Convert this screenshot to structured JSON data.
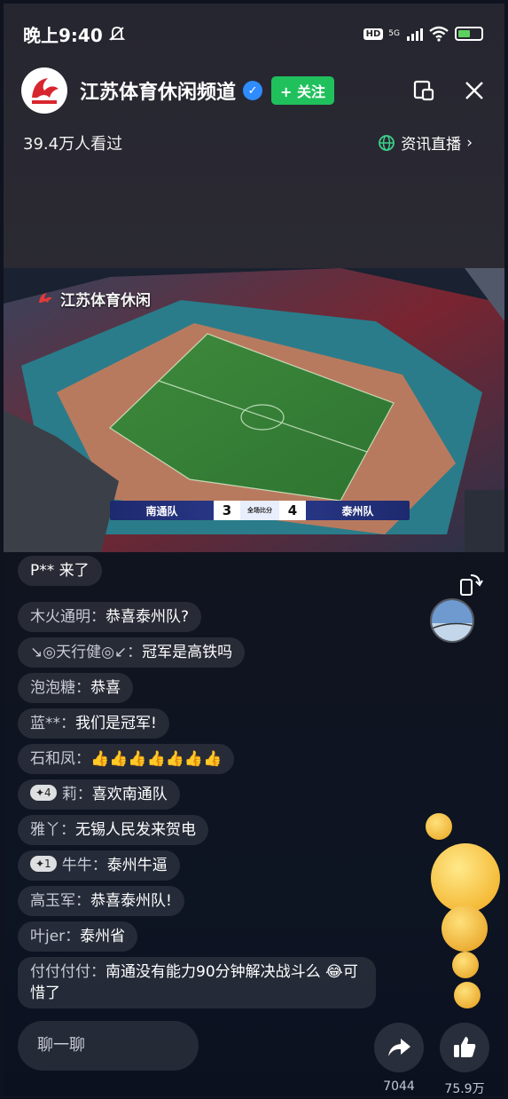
{
  "status_bar": {
    "time": "晚上9:40",
    "hd": "HD",
    "network": "5G"
  },
  "header": {
    "channel_name": "江苏体育休闲频道",
    "follow_label": "+ 关注",
    "viewers": "39.4万人看过",
    "news_live_label": "资讯直播",
    "icons": [
      "minimize-window-icon",
      "close-icon"
    ]
  },
  "video": {
    "watermark": "江苏体育休闲",
    "score": {
      "home_team": "南通队",
      "home_score": "3",
      "away_team": "泰州队",
      "away_score": "4",
      "middle_text": "全场比分"
    }
  },
  "comments": [
    {
      "user": "P** 来了",
      "msg": ""
    },
    {
      "user": "木火通明：",
      "msg": "恭喜泰州队?"
    },
    {
      "user": "↘◎天行健◎↙：",
      "msg": "冠军是高铁吗"
    },
    {
      "user": "泡泡糖：",
      "msg": "恭喜"
    },
    {
      "user": "蓝**：",
      "msg": "我们是冠军!"
    },
    {
      "user": "石和凤：",
      "msg": "👍👍👍👍👍👍👍"
    },
    {
      "badge": "✦4",
      "user": "莉：",
      "msg": "喜欢南通队"
    },
    {
      "user": "雅丫：",
      "msg": "无锡人民发来贺电"
    },
    {
      "badge": "✦1",
      "user": "牛牛：",
      "msg": "泰州牛逼"
    },
    {
      "user": "高玉军：",
      "msg": "恭喜泰州队!"
    },
    {
      "user": "叶jer：",
      "msg": "泰州省"
    },
    {
      "user": "付付付付：",
      "msg": "南通没有能力90分钟解决战斗么 😂可惜了"
    }
  ],
  "bottom": {
    "chat_placeholder": "聊一聊",
    "share_count": "7044",
    "like_count": "75.9万"
  },
  "colors": {
    "follow_green": "#20c05c",
    "verified_blue": "#2f8cff",
    "logo_red": "#d8262e"
  }
}
